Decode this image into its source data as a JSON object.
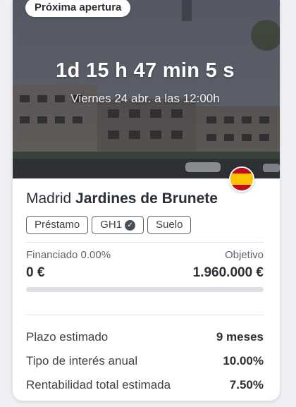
{
  "badge": "Próxima apertura",
  "countdown": "1d 15 h 47 min 5 s",
  "opening_date": "Viernes 24 abr. a las 12:00h",
  "flag_icon": "spain-flag-icon",
  "project": {
    "city": "Madrid",
    "name": "Jardines de Brunete"
  },
  "tags": [
    "Préstamo",
    "GH1",
    "Suelo"
  ],
  "funding": {
    "financed_label": "Financiado 0.00%",
    "financed_value": "0 €",
    "target_label": "Objetivo",
    "target_value": "1.960.000 €",
    "progress_fraction": 0.0
  },
  "details": [
    {
      "label": "Plazo estimado",
      "value": "9 meses"
    },
    {
      "label": "Tipo de interés anual",
      "value": "10.00%"
    },
    {
      "label": "Rentabilidad total estimada",
      "value": "7.50%"
    }
  ],
  "colors": {
    "progress_fill": "#2e7d32",
    "progress_track": "#dcdfe3",
    "text": "#2b2f36"
  }
}
